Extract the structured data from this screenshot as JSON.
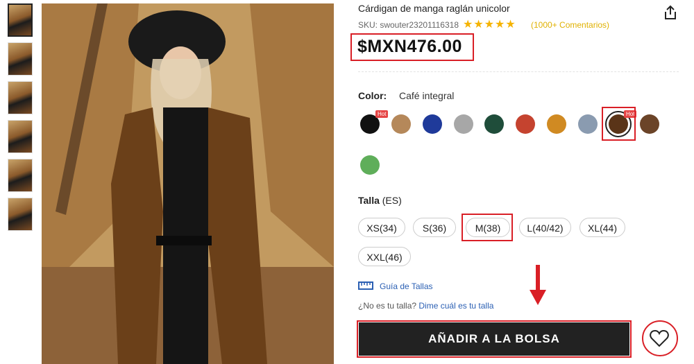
{
  "product": {
    "title": "Cárdigan de manga raglán unicolor",
    "sku": "SKU: swouter23201116318",
    "rating_stars": "★★★★★",
    "reviews": "(1000+ Comentarios)",
    "price": "$MXN476.00"
  },
  "color": {
    "label": "Color:",
    "value": "Café integral",
    "hot_label": "Hot",
    "swatches": [
      {
        "name": "negro",
        "color": "#111111",
        "hot": true
      },
      {
        "name": "caqui",
        "color": "#b5885a"
      },
      {
        "name": "azul",
        "color": "#1f3a9a"
      },
      {
        "name": "gris",
        "color": "#a7a7a7"
      },
      {
        "name": "verde-oscuro",
        "color": "#1f4d3a"
      },
      {
        "name": "rojo",
        "color": "#c5432f"
      },
      {
        "name": "mostaza",
        "color": "#d08a22"
      },
      {
        "name": "gris-azul",
        "color": "#8a9bb0"
      },
      {
        "name": "cafe-integral",
        "color": "#5a3418",
        "hot": true,
        "selected": true
      },
      {
        "name": "cafe-claro",
        "color": "#6b4428"
      },
      {
        "name": "verde-claro",
        "color": "#5fae5a"
      }
    ]
  },
  "size": {
    "label": "Talla",
    "unit": "(ES)",
    "options": [
      "XS(34)",
      "S(36)",
      "M(38)",
      "L(40/42)",
      "XL(44)",
      "XXL(46)"
    ],
    "selected": "M(38)",
    "guide": "Guía de Tallas",
    "fit_question": "¿No es tu talla?",
    "fit_link": "Dime cuál es tu talla"
  },
  "actions": {
    "add_to_bag": "AÑADIR A LA BOLSA"
  }
}
